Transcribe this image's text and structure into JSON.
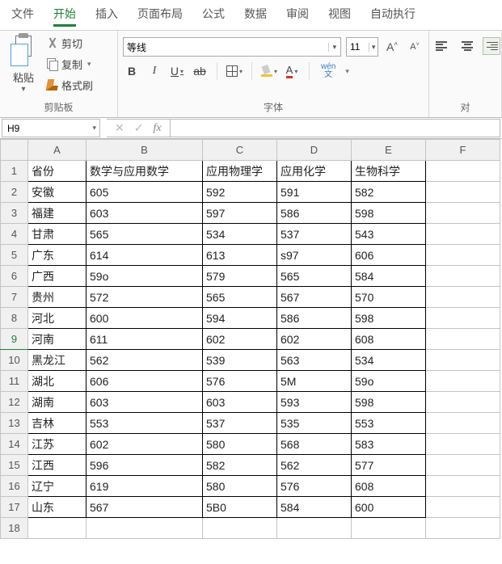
{
  "menu": {
    "tabs": [
      "文件",
      "开始",
      "插入",
      "页面布局",
      "公式",
      "数据",
      "审阅",
      "视图",
      "自动执行"
    ],
    "active_index": 1
  },
  "ribbon": {
    "clipboard": {
      "paste_label": "粘贴",
      "cut_label": "剪切",
      "copy_label": "复制",
      "format_painter_label": "格式刷",
      "group_label": "剪贴板"
    },
    "font": {
      "font_name": "等线",
      "font_size": "11",
      "bold": "B",
      "italic": "I",
      "underline": "U",
      "strike": "ab",
      "wen_top": "wén",
      "wen_bottom": "文",
      "group_label": "字体"
    },
    "align": {
      "group_label": "对"
    }
  },
  "fx": {
    "cell_ref": "H9",
    "fx_label": "fx",
    "formula": ""
  },
  "grid": {
    "col_headers": [
      "A",
      "B",
      "C",
      "D",
      "E",
      "F"
    ],
    "row_headers": [
      "1",
      "2",
      "3",
      "4",
      "5",
      "6",
      "7",
      "8",
      "9",
      "10",
      "11",
      "12",
      "13",
      "14",
      "15",
      "16",
      "17",
      "18"
    ],
    "highlight_row_index": 8,
    "rows": [
      [
        "省份",
        "数学与应用数学",
        "应用物理学",
        "应用化学",
        "生物科学",
        ""
      ],
      [
        "安徽",
        "605",
        "592",
        "591",
        "582",
        ""
      ],
      [
        "福建",
        "603",
        "597",
        "586",
        "598",
        ""
      ],
      [
        "甘肃",
        "565",
        "534",
        "537",
        "543",
        ""
      ],
      [
        "广东",
        "614",
        "613",
        "s97",
        "606",
        ""
      ],
      [
        "广西",
        "59o",
        "579",
        "565",
        "584",
        ""
      ],
      [
        "贵州",
        "572",
        "565",
        "567",
        "570",
        ""
      ],
      [
        "河北",
        "600",
        "594",
        "586",
        "598",
        ""
      ],
      [
        "河南",
        "611",
        "602",
        "602",
        "608",
        ""
      ],
      [
        "黑龙江",
        "562",
        "539",
        "563",
        "534",
        ""
      ],
      [
        "湖北",
        "606",
        "576",
        "5M",
        "59o",
        ""
      ],
      [
        "湖南",
        "603",
        "603",
        "593",
        "598",
        ""
      ],
      [
        "吉林",
        "553",
        "537",
        "535",
        "553",
        ""
      ],
      [
        "江苏",
        "602",
        "580",
        "568",
        "583",
        ""
      ],
      [
        "江西",
        "596",
        "582",
        "562",
        "577",
        ""
      ],
      [
        "辽宁",
        "619",
        "580",
        "576",
        "608",
        ""
      ],
      [
        "山东",
        "567",
        "5B0",
        "584",
        "600",
        ""
      ],
      [
        "",
        "",
        "",
        "",
        "",
        ""
      ]
    ],
    "data_col_count": 5,
    "data_row_count": 17
  }
}
